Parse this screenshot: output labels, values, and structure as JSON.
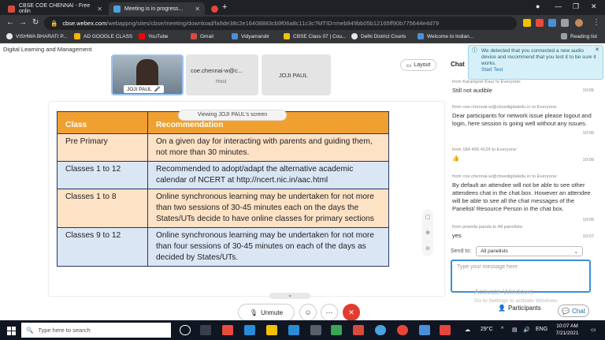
{
  "browser": {
    "tabs": [
      {
        "label": "CBSE COE CHENNAI - Free onlin",
        "active": false,
        "fav_color": "#d54b3d"
      },
      {
        "label": "Meeting is in progress...",
        "active": true,
        "fav_color": "#4aa3df"
      },
      {
        "label": "",
        "active": false,
        "fav_color": "#e8453c"
      }
    ],
    "url_host": "cbse.webex.com",
    "url_path": "/webappng/sites/cbse/meeting/download/fa9de38c2e16408883cb9f06a8c11c3c?MTID=meb949bb05b12165ff90b775644e4d79",
    "bookmarks": [
      "VISHWA BHARATI P...",
      "AD GOOGLE CLASS",
      "YouTube",
      "Gmail",
      "Vidyamandir",
      "CBSE Class 07 | Cou...",
      "Delhi District Courts",
      "Welcome to Indian...",
      "Reading list"
    ]
  },
  "meeting": {
    "breadcrumb": "Digital Learning and Management",
    "participants": {
      "video_name": "JOJI PAUL",
      "host_name": "coe.chennai-w@c...",
      "host_role": "Host",
      "other_name": "JOJI PAUL"
    },
    "layout_label": "Layout",
    "viewing_banner": "Viewing JOJI PAUL's screen",
    "table": {
      "headers": [
        "Class",
        "Recommendation"
      ],
      "rows": [
        {
          "class": "Pre Primary",
          "rec": "On a given day for interacting with parents and guiding them, not more than 30 minutes."
        },
        {
          "class": "Classes 1 to 12",
          "rec": "Recommended to adopt/adapt the alternative academic calendar of NCERT at http://ncert.nic.in/aac.html"
        },
        {
          "class": "Classes 1 to 8",
          "rec": "Online synchronous learning may be undertaken for not more than two sessions of 30-45 minutes each on the days the States/UTs decide to have online classes for primary sections"
        },
        {
          "class": "Classes 9 to 12",
          "rec": "Online synchronous learning may be undertaken for not more than four sessions of  30-45 minutes on each of the days as decided by States/UTs."
        }
      ]
    },
    "controls": {
      "unmute": "Unmute"
    }
  },
  "chat": {
    "title": "Chat",
    "toast": {
      "text": "We detected that you connected a new audio device and recommend that you test it to be sure it works.",
      "link": "Start Test"
    },
    "messages": [
      {
        "from": "from Karamjeet Kaur to Everyone:",
        "body": "Still not audible",
        "time": "10:05"
      },
      {
        "from": "from coe.chennai-w@cbsedigitaledu.in to Everyone:",
        "body": "Dear participants for network issue please logout and login, here session is going well without any issues.",
        "time": "10:06"
      },
      {
        "from": "from 184 450 4124 to Everyone:",
        "body": "👍",
        "time": "10:06"
      },
      {
        "from": "from coe.chennai-w@cbsedigitaledu.in to Everyone:",
        "body": "By default an attendee will not be able to see other attendees chat in the chat box. However an attendee will be able to see all the chat messages of the Panelist/ Resource Person in the chat box.",
        "time": "10:06"
      },
      {
        "from": "from pramila panda to All panelists:",
        "body": "yes",
        "time": "10:07"
      }
    ],
    "send_to_label": "Send to:",
    "send_to_value": "All panelists",
    "input_placeholder": "Type your message here",
    "activate_title": "Activate Windows",
    "activate_sub": "Go to Settings to activate Windows.",
    "participants_btn": "Participants",
    "chat_btn": "Chat"
  },
  "taskbar": {
    "search_placeholder": "Type here to search",
    "weather": "29°C",
    "language": "ENG",
    "time": "10:07 AM",
    "date": "7/21/2021"
  }
}
